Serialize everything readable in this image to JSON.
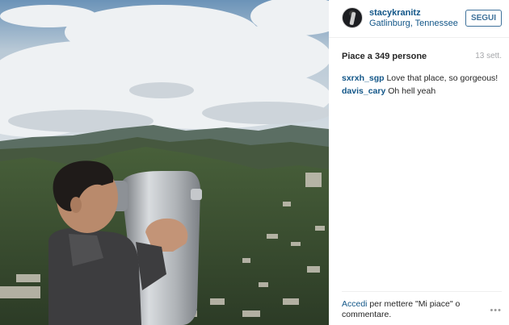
{
  "post": {
    "author": {
      "username": "stacykranitz",
      "location": "Gatlinburg, Tennessee"
    },
    "follow_label": "SEGUI",
    "likes_text": "Piace a 349 persone",
    "timestamp": "13 sett.",
    "comments": [
      {
        "user": "sxrxh_sgp",
        "text": "Love that place, so gorgeous!"
      },
      {
        "user": "davis_cary",
        "text": "Oh hell yeah"
      }
    ],
    "footer": {
      "login_link": "Accedi",
      "login_rest": " per mettere \"Mi piace\" o commentare.",
      "more_icon": "ellipsis-icon"
    }
  },
  "colors": {
    "link_blue": "#125688",
    "follow_border": "#3f729b",
    "muted": "#a5a7aa"
  }
}
